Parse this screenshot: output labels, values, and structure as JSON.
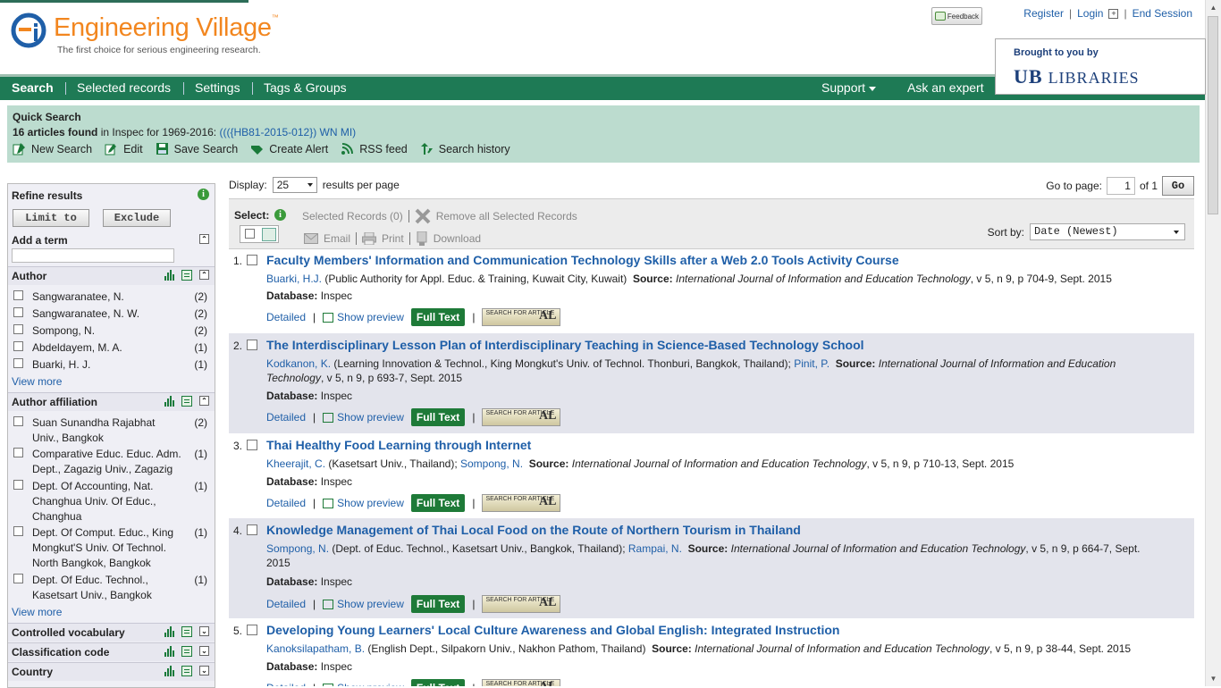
{
  "header": {
    "logo_title": "Engineering Village",
    "logo_tm": "™",
    "tagline": "The first choice for serious engineering research.",
    "feedback_label": "Feedback",
    "top_links": {
      "register": "Register",
      "login": "Login",
      "end_session": "End Session"
    },
    "brought_by": "Brought to you by",
    "library_logo_text": "LIBRARIES",
    "library_logo_mark": "UB"
  },
  "nav": {
    "items": [
      "Search",
      "Selected records",
      "Settings",
      "Tags & Groups"
    ],
    "support": "Support",
    "ask_expert": "Ask an expert"
  },
  "quick_search": {
    "title": "Quick Search",
    "count_text": "16 articles found",
    "in_text": " in Inspec for 1969-2016: ",
    "query": "((({HB81-2015-012}) WN MI)",
    "actions": [
      "New Search",
      "Edit",
      "Save Search",
      "Create Alert",
      "RSS feed",
      "Search history"
    ]
  },
  "sidebar": {
    "refine_title": "Refine results",
    "limit_to": "Limit to",
    "exclude": "Exclude",
    "add_term": "Add a term",
    "author": {
      "title": "Author",
      "items": [
        {
          "label": "Sangwaranatee, N.",
          "count": "(2)"
        },
        {
          "label": "Sangwaranatee, N. W.",
          "count": "(2)"
        },
        {
          "label": "Sompong, N.",
          "count": "(2)"
        },
        {
          "label": "Abdeldayem, M. A.",
          "count": "(1)"
        },
        {
          "label": "Buarki, H. J.",
          "count": "(1)"
        }
      ],
      "view_more": "View more"
    },
    "affiliation": {
      "title": "Author affiliation",
      "items": [
        {
          "label": "Suan Sunandha Rajabhat Univ., Bangkok",
          "count": "(2)"
        },
        {
          "label": "Comparative Educ. Educ. Adm. Dept., Zagazig Univ., Zagazig",
          "count": "(1)"
        },
        {
          "label": "Dept. Of Accounting, Nat. Changhua Univ. Of Educ., Changhua",
          "count": "(1)"
        },
        {
          "label": "Dept. Of Comput. Educ., King Mongkut'S Univ. Of Technol. North Bangkok, Bangkok",
          "count": "(1)"
        },
        {
          "label": "Dept. Of Educ. Technol., Kasetsart Univ., Bangkok",
          "count": "(1)"
        }
      ],
      "view_more": "View more"
    },
    "collapsed": [
      "Controlled vocabulary",
      "Classification code",
      "Country"
    ]
  },
  "results_controls": {
    "display_label": "Display:",
    "display_value": "25",
    "per_page": "results per page",
    "goto_label": "Go to page:",
    "page_value": "1",
    "of_label": "of 1",
    "go": "Go",
    "select_label": "Select:",
    "selected_records": "Selected Records (0)",
    "remove_all": "Remove all Selected Records",
    "email": "Email",
    "print": "Print",
    "download": "Download",
    "sort_label": "Sort by:",
    "sort_value": "Date (Newest)"
  },
  "result_links": {
    "detailed": "Detailed",
    "preview": "Show preview",
    "fulltext": "Full Text",
    "sfa_small": "SEARCH FOR ARTICLE",
    "sfa_big": "AL",
    "db_label": "Database:"
  },
  "results": [
    {
      "num": "1.",
      "title": "Faculty Members' Information and Communication Technology Skills after a Web 2.0 Tools Activity Course",
      "authors": [
        {
          "name": "Buarki, H.J.",
          "aff": " (Public Authority for Appl. Educ. & Training, Kuwait City, Kuwait)"
        }
      ],
      "source_label": "Source:",
      "journal": "International Journal of Information and Education Technology",
      "details": ", v 5, n 9, p 704-9, Sept. 2015",
      "database": "Inspec"
    },
    {
      "num": "2.",
      "title": "The Interdisciplinary Lesson Plan of Interdisciplinary Teaching in Science-Based Technology School",
      "authors": [
        {
          "name": "Kodkanon, K.",
          "aff": " (Learning Innovation & Technol., King Mongkut's Univ. of Technol. Thonburi, Bangkok, Thailand); "
        },
        {
          "name": "Pinit, P.",
          "aff": ""
        }
      ],
      "source_label": "Source:",
      "journal": "International Journal of Information and Education Technology",
      "details": ", v 5, n 9, p 693-7, Sept. 2015",
      "database": "Inspec"
    },
    {
      "num": "3.",
      "title": "Thai Healthy Food Learning through Internet",
      "authors": [
        {
          "name": "Kheerajit, C.",
          "aff": " (Kasetsart Univ., Thailand); "
        },
        {
          "name": "Sompong, N.",
          "aff": ""
        }
      ],
      "source_label": "Source:",
      "journal": "International Journal of Information and Education Technology",
      "details": ", v 5, n 9, p 710-13, Sept. 2015",
      "database": "Inspec"
    },
    {
      "num": "4.",
      "title": "Knowledge Management of Thai Local Food on the Route of Northern Tourism in Thailand",
      "authors": [
        {
          "name": "Sompong, N.",
          "aff": " (Dept. of Educ. Technol., Kasetsart Univ., Bangkok, Thailand); "
        },
        {
          "name": "Rampai, N.",
          "aff": ""
        }
      ],
      "source_label": "Source:",
      "journal": "International Journal of Information and Education Technology",
      "details": ", v 5, n 9, p 664-7, Sept. 2015",
      "database": "Inspec"
    },
    {
      "num": "5.",
      "title": "Developing Young Learners' Local Culture Awareness and Global English: Integrated Instruction",
      "authors": [
        {
          "name": "Kanoksilapatham, B.",
          "aff": " (English Dept., Silpakorn Univ., Nakhon Pathom, Thailand)"
        }
      ],
      "source_label": "Source:",
      "journal": "International Journal of Information and Education Technology",
      "details": ", v 5, n 9, p 38-44, Sept. 2015",
      "database": "Inspec"
    }
  ]
}
